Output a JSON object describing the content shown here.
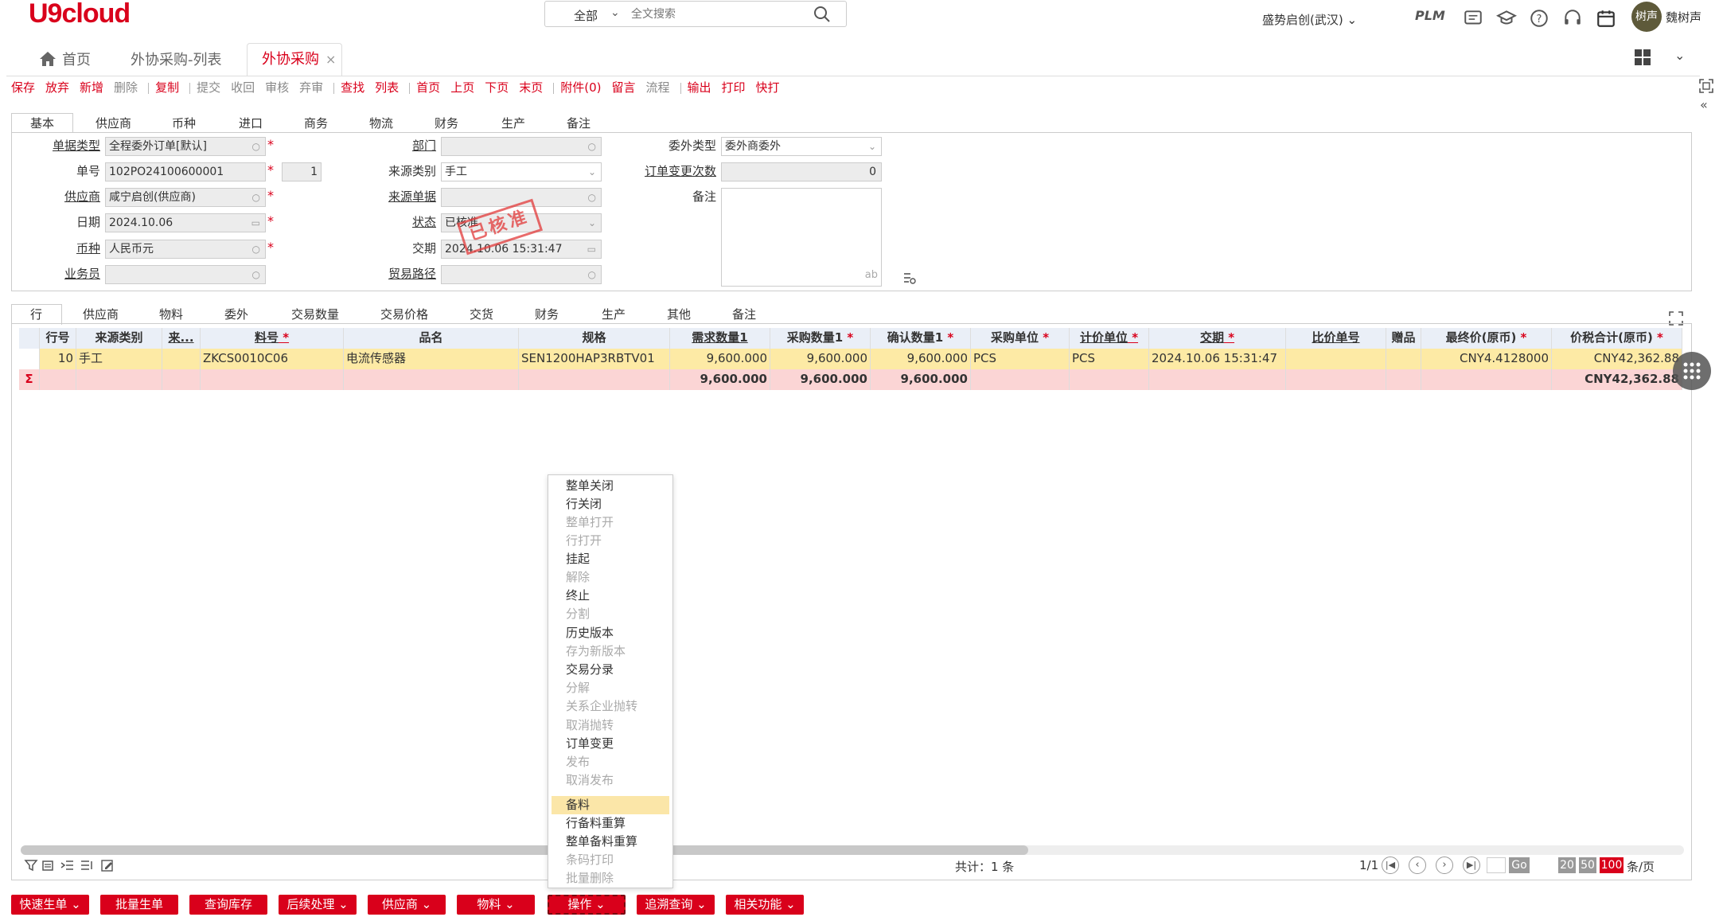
{
  "app": {
    "logo": "U9cloud",
    "company": "盛势启创(武汉)",
    "avatar_text": "树声",
    "username": "魏树声"
  },
  "search": {
    "scope": "全部",
    "placeholder": "全文搜索"
  },
  "toolbar_icons": [
    "plm-icon",
    "message-icon",
    "learn-icon",
    "help-icon",
    "service-icon",
    "calendar-icon"
  ],
  "toolbar_icon_labels": {
    "plm": "PLM"
  },
  "page_tabs": [
    {
      "label": "首页"
    },
    {
      "label": "外协采购-列表"
    },
    {
      "label": "外协采购",
      "active": true
    }
  ],
  "actions": [
    {
      "label": "保存",
      "enabled": true
    },
    {
      "label": "放弃",
      "enabled": true
    },
    {
      "label": "新增",
      "enabled": true
    },
    {
      "label": "删除",
      "enabled": false
    },
    {
      "label": "复制",
      "enabled": true
    },
    {
      "label": "提交",
      "enabled": false
    },
    {
      "label": "收回",
      "enabled": false
    },
    {
      "label": "审核",
      "enabled": false
    },
    {
      "label": "弃审",
      "enabled": false
    },
    {
      "label": "查找",
      "enabled": true
    },
    {
      "label": "列表",
      "enabled": true
    },
    {
      "label": "首页",
      "enabled": true
    },
    {
      "label": "上页",
      "enabled": true
    },
    {
      "label": "下页",
      "enabled": true
    },
    {
      "label": "末页",
      "enabled": true
    },
    {
      "label": "附件(0)",
      "enabled": true
    },
    {
      "label": "留言",
      "enabled": true
    },
    {
      "label": "流程",
      "enabled": false
    },
    {
      "label": "输出",
      "enabled": true
    },
    {
      "label": "打印",
      "enabled": true
    },
    {
      "label": "快打",
      "enabled": true
    }
  ],
  "header_tabs": [
    "基本",
    "供应商",
    "币种",
    "进口",
    "商务",
    "物流",
    "财务",
    "生产",
    "备注"
  ],
  "form": {
    "doc_type": {
      "label": "单据类型",
      "value": "全程委外订单[默认]"
    },
    "doc_no": {
      "label": "单号",
      "value": "102PO24100600001",
      "seq": "1"
    },
    "supplier": {
      "label": "供应商",
      "value": "咸宁启创(供应商)"
    },
    "date": {
      "label": "日期",
      "value": "2024.10.06"
    },
    "currency": {
      "label": "币种",
      "value": "人民币元"
    },
    "salesman": {
      "label": "业务员",
      "value": ""
    },
    "dept": {
      "label": "部门",
      "value": ""
    },
    "source_type": {
      "label": "来源类别",
      "value": "手工"
    },
    "source_doc": {
      "label": "来源单据",
      "value": ""
    },
    "status": {
      "label": "状态",
      "value": "已核准"
    },
    "delivery": {
      "label": "交期",
      "value": "2024.10.06 15:31:47"
    },
    "trade_path": {
      "label": "贸易路径",
      "value": ""
    },
    "outsource_type": {
      "label": "委外类型",
      "value": "委外商委外"
    },
    "change_count": {
      "label": "订单变更次数",
      "value": "0"
    },
    "remark": {
      "label": "备注",
      "value": "",
      "hint": "ab"
    }
  },
  "stamp_text": "已核准",
  "line_tabs": [
    "行",
    "供应商",
    "物料",
    "委外",
    "交易数量",
    "交易价格",
    "交货",
    "财务",
    "生产",
    "其他",
    "备注"
  ],
  "grid": {
    "columns": [
      "行号",
      "来源类别",
      "来...",
      "料号",
      "品名",
      "规格",
      "需求数量1",
      "采购数量1",
      "确认数量1",
      "采购单位",
      "计价单位",
      "交期",
      "比价单号",
      "赠品",
      "最终价(原币)",
      "价税合计(原币)"
    ],
    "rows": [
      [
        "10",
        "手工",
        "",
        "ZKCS0010C06",
        "电流传感器",
        "SEN1200HAP3RBTV01",
        "9,600.000",
        "9,600.000",
        "9,600.000",
        "PCS",
        "PCS",
        "2024.10.06 15:31:47",
        "",
        "",
        "CNY4.4128000",
        "CNY42,362.88"
      ]
    ],
    "sum_symbol": "Σ",
    "sum": [
      "",
      "",
      "",
      "",
      "",
      "",
      "9,600.000",
      "9,600.000",
      "9,600.000",
      "",
      "",
      "",
      "",
      "",
      "",
      "CNY42,362.88"
    ]
  },
  "footer": {
    "total": "共计：1 条",
    "page": "1/1",
    "go": "Go",
    "page_sizes": [
      "20",
      "50",
      "100"
    ],
    "per_page": "条/页"
  },
  "context_menu": [
    {
      "label": "整单关闭",
      "enabled": true
    },
    {
      "label": "行关闭",
      "enabled": true
    },
    {
      "label": "整单打开",
      "enabled": false
    },
    {
      "label": "行打开",
      "enabled": false
    },
    {
      "label": "挂起",
      "enabled": true
    },
    {
      "label": "解除",
      "enabled": false
    },
    {
      "label": "终止",
      "enabled": true
    },
    {
      "label": "分割",
      "enabled": false
    },
    {
      "label": "历史版本",
      "enabled": true
    },
    {
      "label": "存为新版本",
      "enabled": false
    },
    {
      "label": "交易分录",
      "enabled": true
    },
    {
      "label": "分解",
      "enabled": false
    },
    {
      "label": "关系企业抛转",
      "enabled": false
    },
    {
      "label": "取消抛转",
      "enabled": false
    },
    {
      "label": "订单变更",
      "enabled": true
    },
    {
      "label": "发布",
      "enabled": false
    },
    {
      "label": "取消发布",
      "enabled": false
    },
    {
      "label": "备料",
      "enabled": true,
      "highlight": true
    },
    {
      "label": "行备料重算",
      "enabled": true
    },
    {
      "label": "整单备料重算",
      "enabled": true
    },
    {
      "label": "条码打印",
      "enabled": false
    },
    {
      "label": "批量删除",
      "enabled": false
    }
  ],
  "bottom_buttons": [
    {
      "label": "快速生单 ⌄"
    },
    {
      "label": "批量生单"
    },
    {
      "label": "查询库存"
    },
    {
      "label": "后续处理 ⌄"
    },
    {
      "label": "供应商 ⌄"
    },
    {
      "label": "物料 ⌄"
    },
    {
      "label": "操作 ⌄",
      "active": true
    },
    {
      "label": "追溯查询 ⌄"
    },
    {
      "label": "相关功能 ⌄"
    }
  ]
}
